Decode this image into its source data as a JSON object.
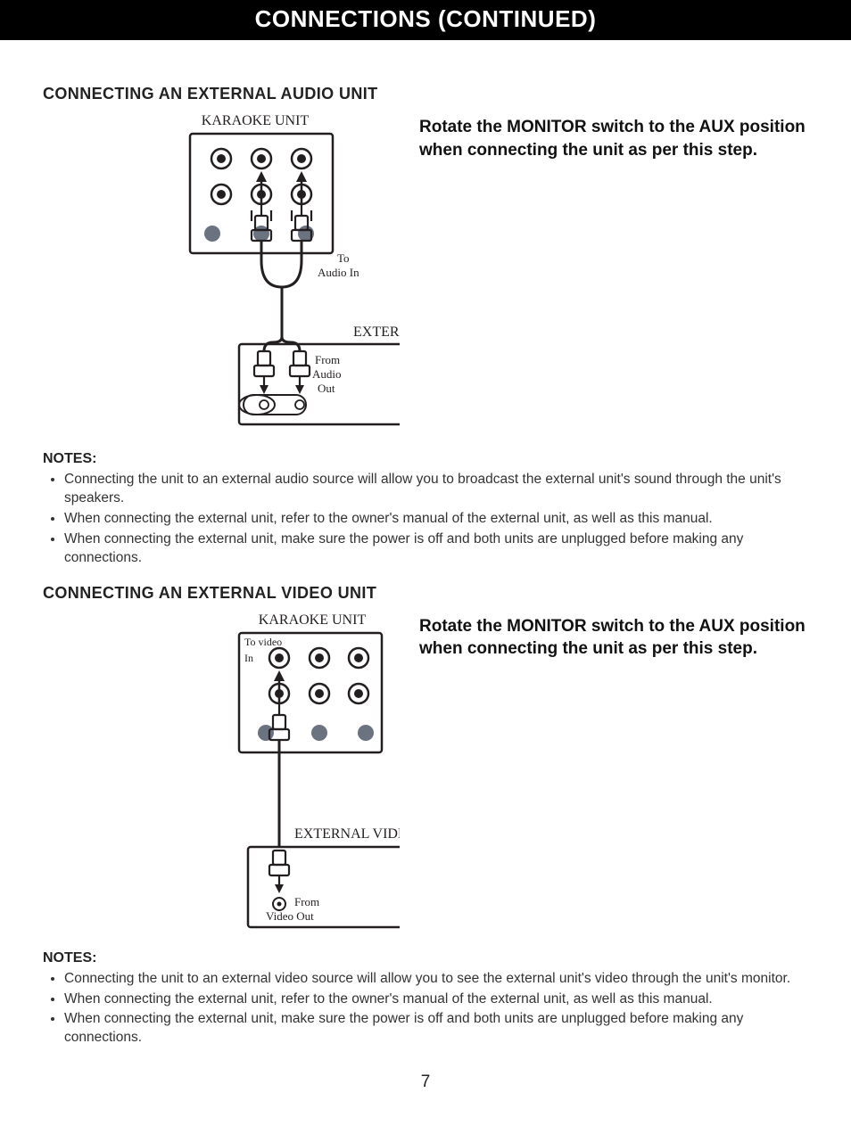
{
  "titleBar": "CONNECTIONS (CONTINUED)",
  "audio": {
    "heading": "CONNECTING AN EXTERNAL AUDIO UNIT",
    "instruction": "Rotate the MONITOR switch to the AUX position when connecting the unit as per this step.",
    "diagram": {
      "karaokeLabel": "KARAOKE UNIT",
      "toAudioIn1": "To",
      "toAudioIn2": "Audio In",
      "externalLabel": "EXTERNAL AUDIO SOURCE",
      "fromAudioOut1": "From",
      "fromAudioOut2": "Audio",
      "fromAudioOut3": "Out"
    },
    "notesHeading": "NOTES:",
    "notes": [
      "Connecting the unit to an external audio source will allow you to broadcast the external unit's sound through the unit's speakers.",
      "When connecting the external unit, refer to the owner's manual of the external unit, as well as this manual.",
      "When connecting the external unit, make sure the power is off and both units are unplugged before making any connections."
    ]
  },
  "video": {
    "heading": "CONNECTING AN EXTERNAL VIDEO UNIT",
    "instruction": "Rotate the MONITOR switch to the AUX position when connecting the unit as per this step.",
    "diagram": {
      "karaokeLabel": "KARAOKE UNIT",
      "toVideoIn1": "To video",
      "toVideoIn2": "In",
      "externalLabel": "EXTERNAL VIDEO SOURCE",
      "fromVideoOut1": "From",
      "fromVideoOut2": "Video Out"
    },
    "notesHeading": "NOTES:",
    "notes": [
      "Connecting the unit to an external video source will allow you to see the external unit's video through the unit's monitor.",
      "When connecting the external unit, refer to the owner's manual of the external unit, as well as this manual.",
      "When connecting the external unit, make sure the power is off and both units are unplugged before making any connections."
    ]
  },
  "pageNumber": "7"
}
